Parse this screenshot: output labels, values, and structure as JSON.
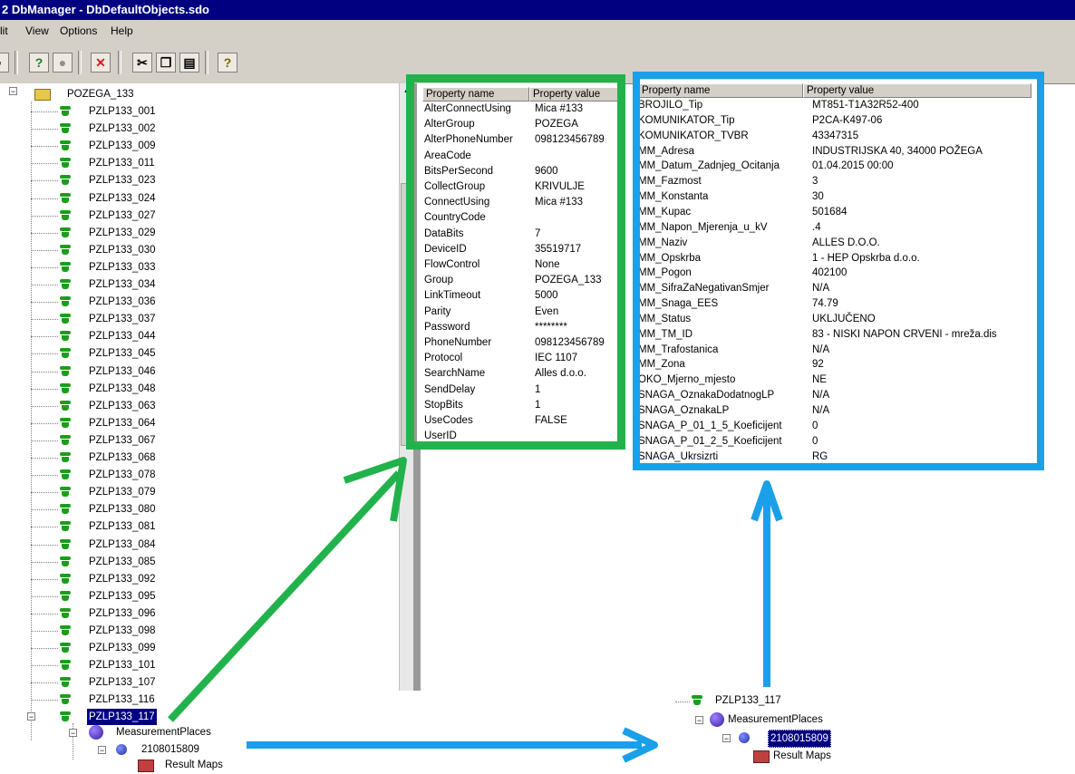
{
  "window": {
    "title": "2 DbManager - DbDefaultObjects.sdo"
  },
  "menu": [
    "lit",
    "View",
    "Options",
    "Help"
  ],
  "tree": {
    "root": "POZEGA_133",
    "items": [
      "PZLP133_001",
      "PZLP133_002",
      "PZLP133_009",
      "PZLP133_011",
      "PZLP133_023",
      "PZLP133_024",
      "PZLP133_027",
      "PZLP133_029",
      "PZLP133_030",
      "PZLP133_033",
      "PZLP133_034",
      "PZLP133_036",
      "PZLP133_037",
      "PZLP133_044",
      "PZLP133_045",
      "PZLP133_046",
      "PZLP133_048",
      "PZLP133_063",
      "PZLP133_064",
      "PZLP133_067",
      "PZLP133_068",
      "PZLP133_078",
      "PZLP133_079",
      "PZLP133_080",
      "PZLP133_081",
      "PZLP133_084",
      "PZLP133_085",
      "PZLP133_092",
      "PZLP133_095",
      "PZLP133_096",
      "PZLP133_098",
      "PZLP133_099",
      "PZLP133_101",
      "PZLP133_107",
      "PZLP133_116"
    ],
    "selected": "PZLP133_117",
    "measurement": "MeasurementPlaces",
    "point": "2108015809",
    "result": "Result Maps"
  },
  "inset_tree": {
    "top": "PZLP133_117",
    "measurement": "MeasurementPlaces",
    "point": "2108015809",
    "result": "Result Maps"
  },
  "props_left": {
    "col_name": "Property name",
    "col_value": "Property value",
    "rows": [
      [
        "AlterConnectUsing",
        "Mica #133"
      ],
      [
        "AlterGroup",
        "POZEGA"
      ],
      [
        "AlterPhoneNumber",
        "098123456789"
      ],
      [
        "AreaCode",
        ""
      ],
      [
        "BitsPerSecond",
        "9600"
      ],
      [
        "CollectGroup",
        "KRIVULJE"
      ],
      [
        "ConnectUsing",
        "Mica #133"
      ],
      [
        "CountryCode",
        ""
      ],
      [
        "DataBits",
        "7"
      ],
      [
        "DeviceID",
        "35519717"
      ],
      [
        "FlowControl",
        "None"
      ],
      [
        "Group",
        "POZEGA_133"
      ],
      [
        "LinkTimeout",
        "5000"
      ],
      [
        "Parity",
        "Even"
      ],
      [
        "Password",
        "********"
      ],
      [
        "PhoneNumber",
        "098123456789"
      ],
      [
        "Protocol",
        "IEC 1107"
      ],
      [
        "SearchName",
        "Alles d.o.o."
      ],
      [
        "SendDelay",
        "1"
      ],
      [
        "StopBits",
        "1"
      ],
      [
        "UseCodes",
        "FALSE"
      ],
      [
        "UserID",
        ""
      ]
    ]
  },
  "props_right": {
    "col_name": "Property name",
    "col_value": "Property value",
    "rows": [
      [
        "BROJILO_Tip",
        "MT851-T1A32R52-400"
      ],
      [
        "KOMUNIKATOR_Tip",
        "P2CA-K497-06"
      ],
      [
        "KOMUNIKATOR_TVBR",
        "43347315"
      ],
      [
        "MM_Adresa",
        "INDUSTRIJSKA 40, 34000 POŽEGA"
      ],
      [
        "MM_Datum_Zadnjeg_Ocitanja",
        "01.04.2015 00:00"
      ],
      [
        "MM_Fazmost",
        "3"
      ],
      [
        "MM_Konstanta",
        "30"
      ],
      [
        "MM_Kupac",
        "501684"
      ],
      [
        "MM_Napon_Mjerenja_u_kV",
        ".4"
      ],
      [
        "MM_Naziv",
        "ALLES D.O.O."
      ],
      [
        "MM_Opskrba",
        "1 - HEP Opskrba d.o.o."
      ],
      [
        "MM_Pogon",
        "402100"
      ],
      [
        "MM_SifraZaNegativanSmjer",
        "N/A"
      ],
      [
        "MM_Snaga_EES",
        "74.79"
      ],
      [
        "MM_Status",
        "UKLJUČENO"
      ],
      [
        "MM_TM_ID",
        "83 - NISKI NAPON CRVENI - mreža.dis"
      ],
      [
        "MM_Trafostanica",
        "N/A"
      ],
      [
        "MM_Zona",
        "92"
      ],
      [
        "OKO_Mjerno_mjesto",
        "NE"
      ],
      [
        "SNAGA_OznakaDodatnogLP",
        "N/A"
      ],
      [
        "SNAGA_OznakaLP",
        "N/A"
      ],
      [
        "SNAGA_P_01_1_5_Koeficijent",
        "0"
      ],
      [
        "SNAGA_P_01_2_5_Koeficijent",
        "0"
      ],
      [
        "SNAGA_Ukrsizrti",
        "RG"
      ]
    ]
  },
  "colors": {
    "titlebar": "#000080",
    "green": "#22b24c",
    "blue": "#1aa0e8",
    "node_icon": "#1a9e1a"
  }
}
